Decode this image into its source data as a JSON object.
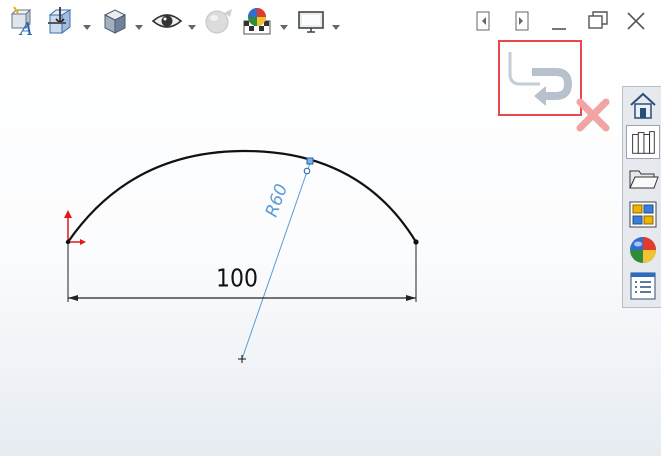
{
  "toolbar": {
    "items": [
      {
        "name": "view-orientation-icon"
      },
      {
        "name": "section-view-icon"
      },
      {
        "name": "display-style-icon"
      },
      {
        "name": "hide-show-items-icon"
      },
      {
        "name": "edit-appearance-icon"
      },
      {
        "name": "apply-scene-icon"
      },
      {
        "name": "view-settings-icon"
      }
    ]
  },
  "window_controls": {
    "items": [
      {
        "name": "collapse-left-pane-icon"
      },
      {
        "name": "collapse-right-pane-icon"
      },
      {
        "name": "minimize-icon"
      },
      {
        "name": "restore-icon"
      },
      {
        "name": "close-icon"
      }
    ]
  },
  "confirmation_corner": {
    "confirm": "exit-sketch-icon",
    "cancel": "cancel-sketch-icon",
    "highlight_color": "#e8474c"
  },
  "sketch": {
    "linear_dimension": "100",
    "radius_dimension": "R60",
    "sketch_color": "#111111",
    "dimension_color": "#000000",
    "radius_color": "#5b9bd5"
  },
  "task_pane": {
    "tabs": [
      {
        "name": "solidworks-resources-tab-icon",
        "active": false
      },
      {
        "name": "design-library-tab-icon",
        "active": true
      },
      {
        "name": "file-explorer-tab-icon",
        "active": false
      },
      {
        "name": "view-palette-tab-icon",
        "active": false
      },
      {
        "name": "appearances-scenes-tab-icon",
        "active": false
      },
      {
        "name": "custom-properties-tab-icon",
        "active": false
      }
    ]
  }
}
